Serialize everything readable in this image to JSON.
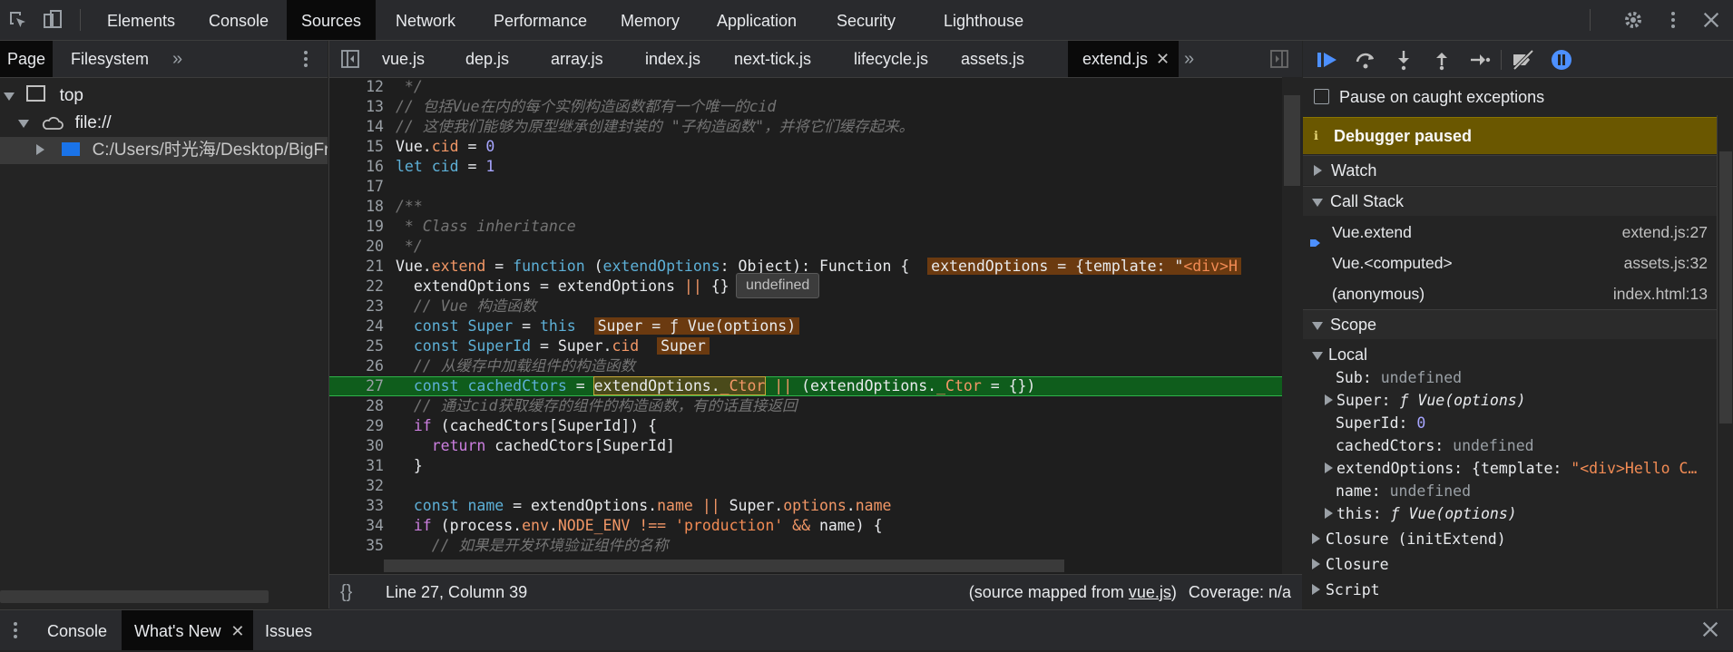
{
  "toolbar": {
    "tabs": [
      "Elements",
      "Console",
      "Sources",
      "Network",
      "Performance",
      "Memory",
      "Application",
      "Security",
      "Lighthouse"
    ],
    "active_tab": "Sources"
  },
  "navigator": {
    "tabs": [
      "Page",
      "Filesystem"
    ],
    "tree": {
      "top": "top",
      "origin": "file://",
      "folder": "C:/Users/时光海/Desktop/BigFron"
    }
  },
  "editor": {
    "file_tabs": [
      "vue.js",
      "dep.js",
      "array.js",
      "index.js",
      "next-tick.js",
      "lifecycle.js",
      "assets.js",
      "extend.js"
    ],
    "active_file": "extend.js",
    "lines": [
      {
        "n": "12",
        "html": "<span class='cm'> */</span>"
      },
      {
        "n": "13",
        "html": "<span class='cm'>// 包括Vue在内的每个实例构造函数都有一个唯一的cid</span>"
      },
      {
        "n": "14",
        "html": "<span class='cm'>// 这使我们能够为原型继承创建封装的 \"子构造函数\"，并将它们缓存起来。</span>"
      },
      {
        "n": "15",
        "html": "Vue.<span class='pr'>cid</span> = <span class='nm'>0</span>"
      },
      {
        "n": "16",
        "html": "<span class='kb'>let</span> <span class='kb'>cid</span> = <span class='nm'>1</span>"
      },
      {
        "n": "17",
        "html": ""
      },
      {
        "n": "18",
        "html": "<span class='cm'>/**</span>"
      },
      {
        "n": "19",
        "html": "<span class='cm'> * Class inheritance</span>"
      },
      {
        "n": "20",
        "html": "<span class='cm'> */</span>"
      },
      {
        "n": "21",
        "html": "Vue.<span class='pr'>extend</span> = <span class='kb'>function</span> (<span class='kb'>extendOptions</span>: Object): Function {  <span class='inl'>extendOptions = {template: \"<span class='st'>&lt;div&gt;H</span></span>"
      },
      {
        "n": "22",
        "html": "  extendOptions = extendOptions <span class='pr'>||</span> {}"
      },
      {
        "n": "23",
        "html": "  <span class='cm'>// Vue 构造函数</span>"
      },
      {
        "n": "24",
        "html": "  <span class='kb'>const</span> <span class='kb'>Super</span> = <span class='kb'>this</span>  <span class='inl'>Super = ƒ Vue(options)</span>"
      },
      {
        "n": "25",
        "html": "  <span class='kb'>const</span> <span class='kb'>SuperId</span> = Super.<span class='pr'>cid</span>  <span class='inl'>Super</span>"
      },
      {
        "n": "26",
        "html": "  <span class='cm'>// 从缓存中加载组件的构造函数</span>"
      },
      {
        "n": "27",
        "html": "  <span class='kb'>const</span> <span class='kb'>cachedCtors</span> = <span style='background:#4a4a1a;outline:1px solid #c8a93a'>extendOptions.<span class='pr'>_Ctor</span></span> <span class='pr'>||</span> (extendOptions.<span class='pr'>_Ctor</span> = {})",
        "hl": true
      },
      {
        "n": "28",
        "html": "  <span class='cm'>// 通过cid获取缓存的组件的构造函数，有的话直接返回</span>"
      },
      {
        "n": "29",
        "html": "  <span class='kw'>if</span> (cachedCtors[SuperId]) {"
      },
      {
        "n": "30",
        "html": "    <span class='kw'>return</span> cachedCtors[SuperId]"
      },
      {
        "n": "31",
        "html": "  }"
      },
      {
        "n": "32",
        "html": ""
      },
      {
        "n": "33",
        "html": "  <span class='kb'>const</span> <span class='kb'>name</span> = extendOptions.<span class='pr'>name</span> <span class='pr'>||</span> Super.<span class='pr'>options</span>.<span class='pr'>name</span>"
      },
      {
        "n": "34",
        "html": "  <span class='kw'>if</span> (process.<span class='pr'>env</span>.<span class='pr'>NODE_ENV</span> <span class='pr'>!==</span> <span class='st'>'production'</span> <span class='pr'>&amp;&amp;</span> name) {"
      },
      {
        "n": "35",
        "html": "    <span class='cm'>// 如果是开发环境验证组件的名称</span>"
      }
    ],
    "tooltip": "undefined",
    "status": {
      "position": "Line 27, Column 39",
      "source_mapped_prefix": "(source mapped from ",
      "source_mapped_file": "vue.js",
      "source_mapped_suffix": ")",
      "coverage": "Coverage: n/a"
    }
  },
  "debugger": {
    "pause_on_caught": "Pause on caught exceptions",
    "paused_banner": "Debugger paused",
    "sections": {
      "watch": "Watch",
      "call_stack": "Call Stack",
      "scope": "Scope"
    },
    "call_stack": [
      {
        "fn": "Vue.extend",
        "loc": "extend.js:27"
      },
      {
        "fn": "Vue.<computed>",
        "loc": "assets.js:32"
      },
      {
        "fn": "(anonymous)",
        "loc": "index.html:13"
      }
    ],
    "scope": {
      "local_label": "Local",
      "entries": [
        {
          "key": "Sub",
          "value": "undefined"
        },
        {
          "key": "Super",
          "value": "ƒ Vue(options)"
        },
        {
          "key": "SuperId",
          "value": "0"
        },
        {
          "key": "cachedCtors",
          "value": "undefined"
        },
        {
          "key": "extendOptions",
          "value_prefix": "{template: ",
          "value_str": "\"<div>Hello C…"
        },
        {
          "key": "name",
          "value": "undefined"
        },
        {
          "key": "this",
          "value": "ƒ Vue(options)"
        }
      ],
      "closure_1": "Closure (initExtend)",
      "closure_2": "Closure",
      "script": "Script"
    }
  },
  "drawer": {
    "tabs": [
      "Console",
      "What's New",
      "Issues"
    ],
    "active_tab": "What's New"
  },
  "colors": {
    "paused_banner_bg": "#6a5700",
    "highlight_line": "#0f5d1c",
    "accent_blue": "#4d90fe"
  }
}
